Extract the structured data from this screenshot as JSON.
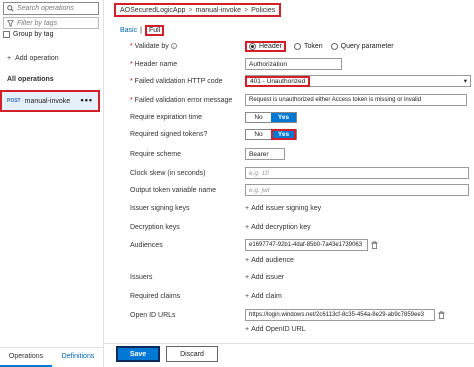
{
  "left": {
    "search_placeholder": "Search operations",
    "filter_placeholder": "Filter by tags",
    "group_by_tag": "Group by tag",
    "add_operation": "Add operation",
    "all_operations": "All operations",
    "selected_op": {
      "verb": "POST",
      "name": "manual-invoke",
      "menu": "•••"
    },
    "tabs": [
      "Operations",
      "Definitions"
    ]
  },
  "breadcrumb": [
    "AOSecuredLogicApp",
    "manual-invoke",
    "Policies"
  ],
  "editor_tabs": {
    "basic": "Basic",
    "full": "Full"
  },
  "form": {
    "validate_by": {
      "label": "Validate by",
      "options": [
        "Header",
        "Token",
        "Query parameter"
      ],
      "selected": "Header"
    },
    "header_name": {
      "label": "Header name",
      "value": "Authorization"
    },
    "failed_code": {
      "label": "Failed validation HTTP code",
      "value": "401 - Unauthorized"
    },
    "failed_msg": {
      "label": "Failed validation error message",
      "value": "Request is unauthorized either Access token is missing or invalid"
    },
    "require_exp": {
      "label": "Require expiration time",
      "no": "No",
      "yes": "Yes",
      "selected": "Yes"
    },
    "require_signed": {
      "label": "Required signed tokens?",
      "no": "No",
      "yes": "Yes",
      "selected": "Yes"
    },
    "require_scheme": {
      "label": "Require scheme",
      "value": "Bearer"
    },
    "clock_skew": {
      "label": "Clock skew (in seconds)",
      "placeholder": "e.g. 10"
    },
    "output_var": {
      "label": "Output token variable name",
      "placeholder": "e.g. jwt"
    },
    "issuer_keys": {
      "label": "Issuer signing keys",
      "add": "Add issuer signing key"
    },
    "decryption_keys": {
      "label": "Decryption keys",
      "add": "Add decryption key"
    },
    "audiences": {
      "label": "Audiences",
      "value": "e1697747-92b1-4daf-85b0-7a43e1739063",
      "add": "Add audience"
    },
    "issuers": {
      "label": "Issuers",
      "add": "Add issuer"
    },
    "claims": {
      "label": "Required claims",
      "add": "Add claim"
    },
    "openid": {
      "label": "Open ID URLs",
      "value": "https://login.windows.net/2c6113cf-8c35-454a-8e29-ab9c7859ee3",
      "add": "Add OpenID URL"
    }
  },
  "buttons": {
    "save": "Save",
    "discard": "Discard"
  },
  "colors": {
    "accent": "#0078d4",
    "highlight": "#d1202a"
  }
}
